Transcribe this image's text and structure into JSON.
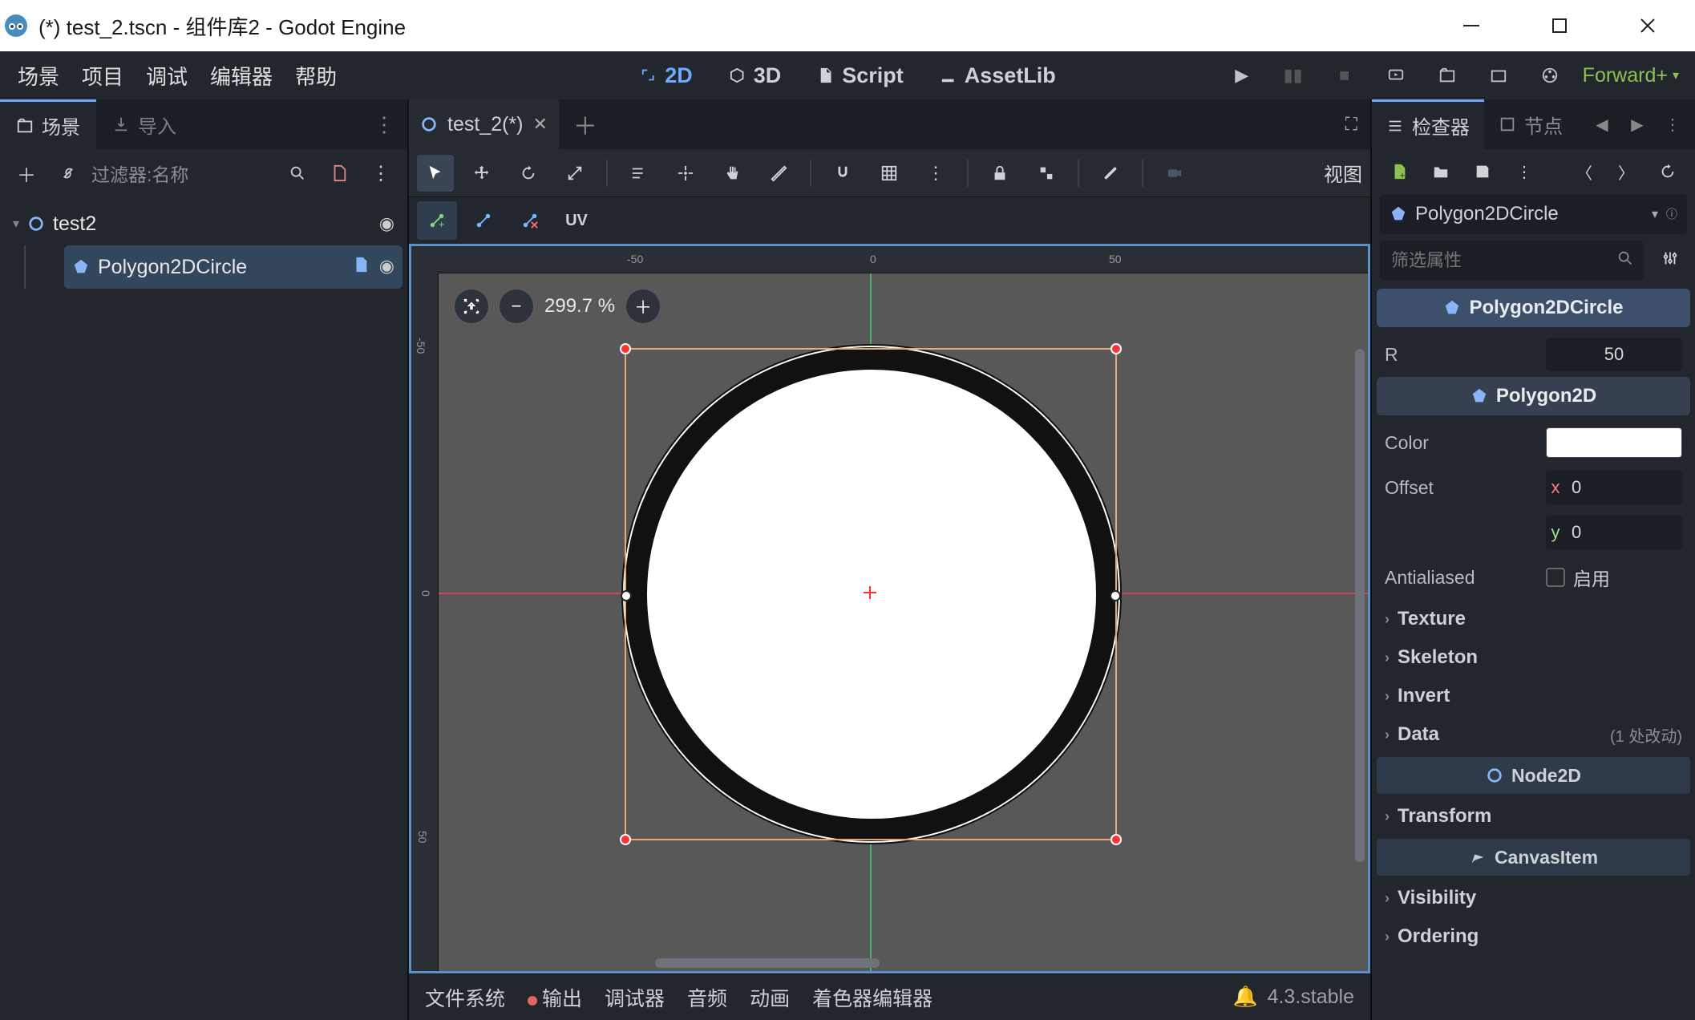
{
  "window": {
    "title": "(*) test_2.tscn - 组件库2 - Godot Engine"
  },
  "menubar": {
    "scene": "场景",
    "project": "项目",
    "debug": "调试",
    "editor": "编辑器",
    "help": "帮助",
    "view2d": "2D",
    "view3d": "3D",
    "script": "Script",
    "assetlib": "AssetLib",
    "renderer": "Forward+"
  },
  "left": {
    "tab_scene": "场景",
    "tab_import": "导入",
    "filter_placeholder": "过滤器:名称",
    "root": "test2",
    "child": "Polygon2DCircle"
  },
  "center": {
    "tab_name": "test_2(*)",
    "view_button": "视图",
    "zoom": "299.7 %",
    "uv": "UV",
    "ruler_top_n50": "-50",
    "ruler_top_0": "0",
    "ruler_top_50": "50",
    "ruler_left_n50": "-50",
    "ruler_left_0": "0",
    "ruler_left_50": "50"
  },
  "bottom": {
    "filesystem": "文件系统",
    "output": "输出",
    "debugger": "调试器",
    "audio": "音频",
    "animation": "动画",
    "shader": "着色器编辑器",
    "version": "4.3.stable"
  },
  "right": {
    "tab_inspector": "检查器",
    "tab_node": "节点",
    "node_selected": "Polygon2DCircle",
    "filter_placeholder": "筛选属性",
    "sec_poly2dcircle": "Polygon2DCircle",
    "prop_r": "R",
    "val_r": "50",
    "sec_polygon2d": "Polygon2D",
    "prop_color": "Color",
    "prop_offset": "Offset",
    "offset_x": "0",
    "offset_y": "0",
    "prop_aa": "Antialiased",
    "aa_enable": "启用",
    "grp_texture": "Texture",
    "grp_skeleton": "Skeleton",
    "grp_invert": "Invert",
    "grp_data": "Data",
    "data_meta": "(1 处改动)",
    "class_node2d": "Node2D",
    "grp_transform": "Transform",
    "class_canvasitem": "CanvasItem",
    "grp_visibility": "Visibility",
    "grp_ordering": "Ordering"
  }
}
